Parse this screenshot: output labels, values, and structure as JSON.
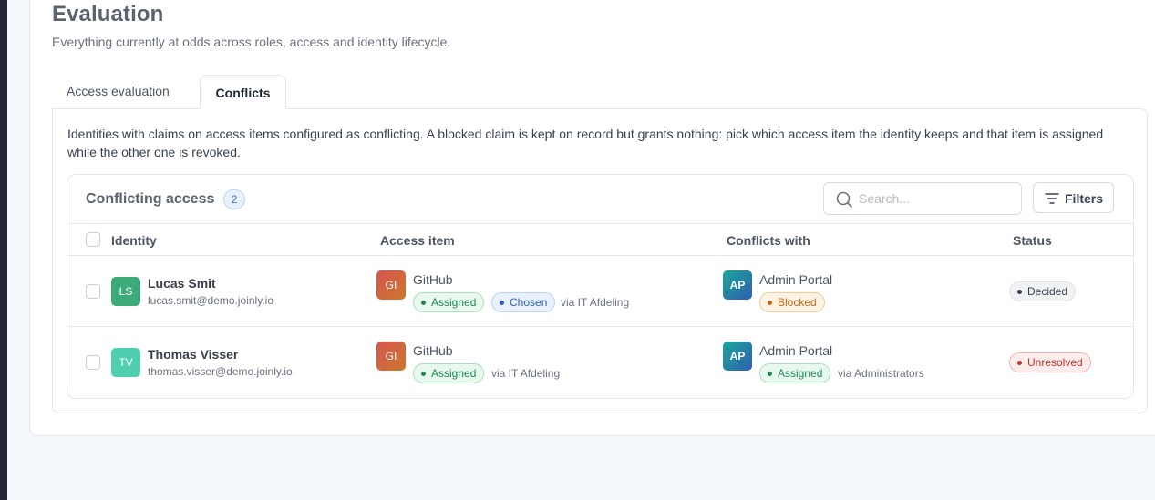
{
  "page": {
    "title": "Evaluation",
    "subtitle": "Everything currently at odds across roles, access and identity lifecycle."
  },
  "tabs": [
    {
      "label": "Access evaluation",
      "active": false
    },
    {
      "label": "Conflicts",
      "active": true
    }
  ],
  "panel": {
    "description": "Identities with claims on access items configured as conflicting. A blocked claim is kept on record but grants nothing: pick which access item the identity keeps and that item is assigned while the other one is revoked."
  },
  "table": {
    "title": "Conflicting access",
    "count": "2",
    "search_placeholder": "Search...",
    "filters_label": "Filters",
    "columns": [
      "Identity",
      "Access item",
      "Conflicts with",
      "Status"
    ],
    "rows": [
      {
        "identity": {
          "initials": "LS",
          "name": "Lucas Smit",
          "email": "lucas.smit@demo.joinly.io"
        },
        "access_item": {
          "initials": "GI",
          "name": "GitHub",
          "badges": [
            "Assigned",
            "Chosen"
          ],
          "via": "via IT Afdeling"
        },
        "conflicts_with": {
          "initials": "AP",
          "name": "Admin Portal",
          "badges": [
            "Blocked"
          ],
          "via": ""
        },
        "status": "Decided"
      },
      {
        "identity": {
          "initials": "TV",
          "name": "Thomas Visser",
          "email": "thomas.visser@demo.joinly.io"
        },
        "access_item": {
          "initials": "GI",
          "name": "GitHub",
          "badges": [
            "Assigned"
          ],
          "via": "via IT Afdeling"
        },
        "conflicts_with": {
          "initials": "AP",
          "name": "Admin Portal",
          "badges": [
            "Assigned"
          ],
          "via": "via Administrators"
        },
        "status": "Unresolved"
      }
    ]
  },
  "colors": {
    "avatar_ls": "#3daa7a",
    "avatar_tv": "#4fcfb0",
    "github_gradient": [
      "#d9534f",
      "#c97a2e"
    ],
    "admin_portal_gradient": [
      "#1aa69a",
      "#2f5fb0"
    ],
    "badge_green": "#1f8a4c",
    "badge_blue": "#2d63b5",
    "badge_orange": "#c76a12",
    "badge_red": "#c2352b"
  }
}
